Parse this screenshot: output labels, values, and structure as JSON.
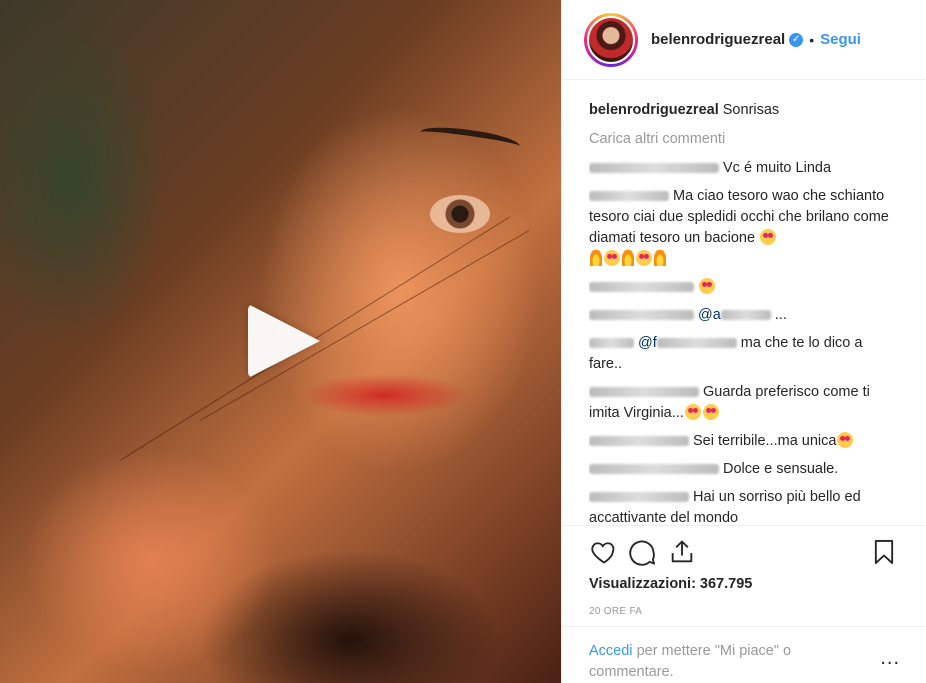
{
  "post": {
    "username": "belenrodriguezreal",
    "follow_label": "Segui",
    "separator": "•",
    "caption_text": "Sonrisas"
  },
  "comments": {
    "load_more": "Carica altri commenti",
    "items": [
      {
        "text": "Vc é muito Linda"
      },
      {
        "text": "Ma ciao tesoro wao che schianto tesoro ciai due spledidi occhi che brilano come diamati tesoro un bacione"
      },
      {
        "text": ""
      },
      {
        "mention": "@a",
        "text": "..."
      },
      {
        "mention": "@f",
        "text": "ma che te lo dico a fare.."
      },
      {
        "text": "Guarda preferisco come ti imita Virginia..."
      },
      {
        "text": "Sei terribile...ma unica"
      },
      {
        "text": "Dolce e sensuale."
      },
      {
        "text": "Hai un sorriso più bello ed accattivante del mondo"
      }
    ]
  },
  "stats": {
    "views": "Visualizzazioni: 367.795",
    "time_ago": "20 ORE FA"
  },
  "footer": {
    "login_link": "Accedi",
    "login_rest": "per mettere \"Mi piace\" o commentare.",
    "more": "..."
  },
  "icons": {
    "like": "heart-icon",
    "comment": "comment-icon",
    "share": "share-icon",
    "save": "bookmark-icon",
    "verified": "verified-icon",
    "play": "play-icon"
  },
  "colors": {
    "link": "#3897f0",
    "muted": "#999999",
    "text": "#262626"
  }
}
